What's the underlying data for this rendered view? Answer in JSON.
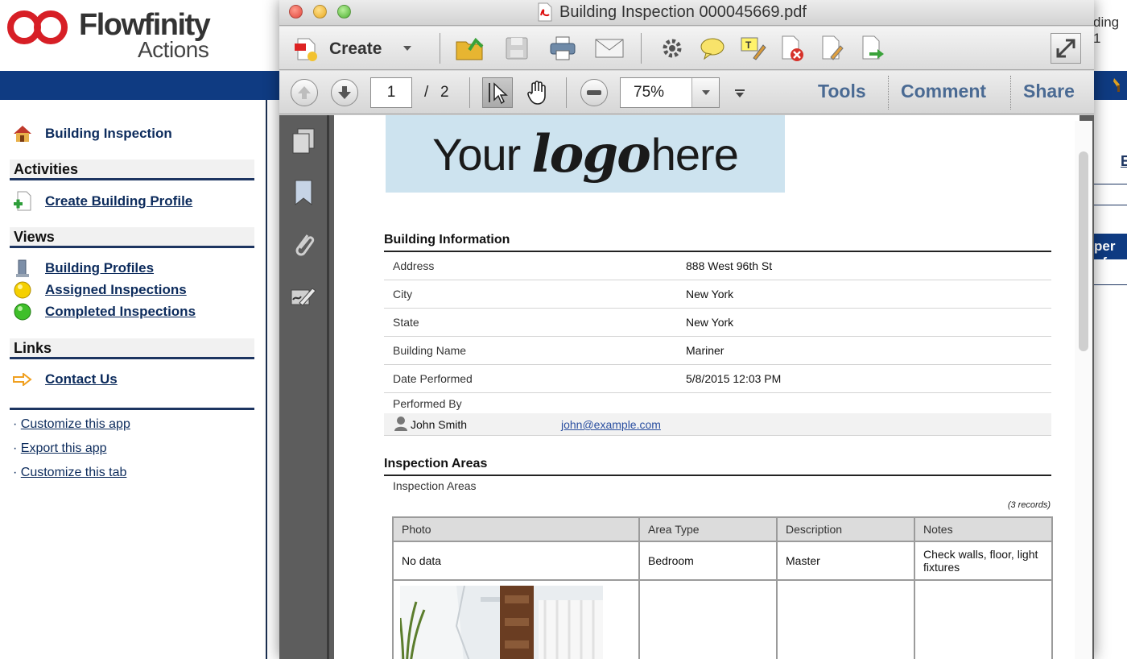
{
  "app": {
    "brand": "Flowfinity",
    "brand_sub": "Actions",
    "panel_title": "Building Inspection",
    "sections": {
      "activities": "Activities",
      "views": "Views",
      "links": "Links"
    },
    "activities": [
      "Create Building Profile"
    ],
    "views": [
      "Building Profiles",
      "Assigned Inspections",
      "Completed Inspections"
    ],
    "links": [
      "Contact Us"
    ],
    "bottom_links": [
      "Customize this app",
      "Export this app",
      "Customize this tab"
    ],
    "bullet": "·",
    "right_fragments": {
      "top": "ding 1",
      "mid": "E",
      "lower": "per of"
    }
  },
  "pdf": {
    "window_title": "Building Inspection 000045669.pdf",
    "create_label": "Create",
    "page_current": "1",
    "page_sep": "/",
    "page_total": "2",
    "zoom": "75%",
    "tabs": [
      "Tools",
      "Comment",
      "Share"
    ],
    "logo": {
      "part1": "Your",
      "part2": "logo",
      "part3": "here"
    },
    "building_info": {
      "title": "Building Information",
      "rows": [
        {
          "label": "Address",
          "value": "888 West 96th St"
        },
        {
          "label": "City",
          "value": "New York"
        },
        {
          "label": "State",
          "value": "New York"
        },
        {
          "label": "Building Name",
          "value": "Mariner"
        },
        {
          "label": "Date Performed",
          "value": "5/8/2015 12:03 PM"
        }
      ],
      "performed_by_label": "Performed By",
      "performer_name": "John Smith",
      "performer_email": "john@example.com"
    },
    "inspection_areas": {
      "title": "Inspection Areas",
      "sublabel": "Inspection Areas",
      "record_count": "(3 records)",
      "columns": [
        "Photo",
        "Area Type",
        "Description",
        "Notes"
      ],
      "rows": [
        {
          "photo": "No data",
          "area_type": "Bedroom",
          "description": "Master",
          "notes": "Check walls, floor, light fixtures"
        },
        {
          "photo": "",
          "area_type": "",
          "description": "",
          "notes": ""
        }
      ]
    }
  }
}
